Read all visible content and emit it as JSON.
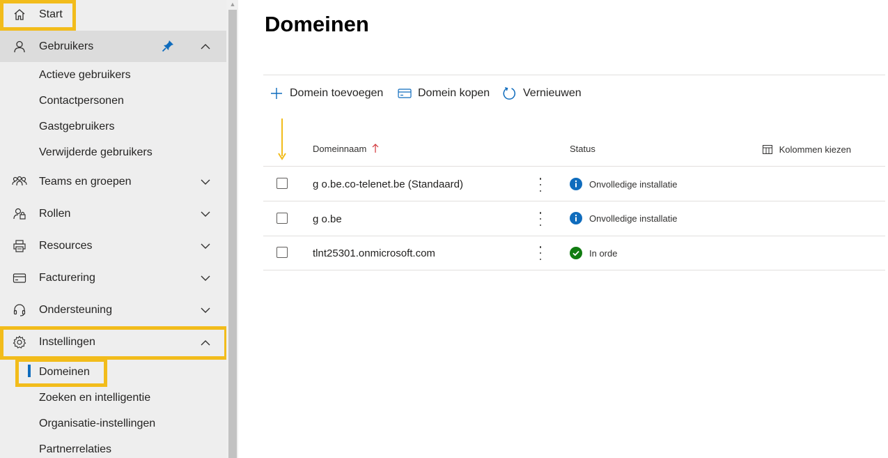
{
  "sidebar": {
    "items": [
      {
        "label": "Start",
        "icon": "home-icon"
      },
      {
        "label": "Gebruikers",
        "icon": "person-icon"
      },
      {
        "label": "Teams en groepen",
        "icon": "people-icon"
      },
      {
        "label": "Rollen",
        "icon": "role-icon"
      },
      {
        "label": "Resources",
        "icon": "printer-icon"
      },
      {
        "label": "Facturering",
        "icon": "credit-card-icon"
      },
      {
        "label": "Ondersteuning",
        "icon": "headset-icon"
      },
      {
        "label": "Instellingen",
        "icon": "gear-icon"
      }
    ],
    "users_sub": [
      "Actieve gebruikers",
      "Contactpersonen",
      "Gastgebruikers",
      "Verwijderde gebruikers"
    ],
    "settings_sub": [
      "Domeinen",
      "Zoeken en intelligentie",
      "Organisatie-instellingen",
      "Partnerrelaties"
    ]
  },
  "main": {
    "title": "Domeinen",
    "commands": {
      "add": "Domein toevoegen",
      "buy": "Domein kopen",
      "refresh": "Vernieuwen"
    },
    "columns": {
      "name": "Domeinnaam",
      "status": "Status",
      "choose": "Kolommen kiezen"
    },
    "rows": [
      {
        "domain": "g        o.be.co-telenet.be (Standaard)",
        "status": "Onvolledige installatie",
        "status_type": "info"
      },
      {
        "domain": "g        o.be",
        "status": "Onvolledige installatie",
        "status_type": "info"
      },
      {
        "domain": "tlnt25301.onmicrosoft.com",
        "status": "In orde",
        "status_type": "ok"
      }
    ]
  },
  "colors": {
    "highlight": "#f2bc1b",
    "accent": "#0f6cbd",
    "info": "#0f6cbd",
    "ok": "#107c10"
  }
}
